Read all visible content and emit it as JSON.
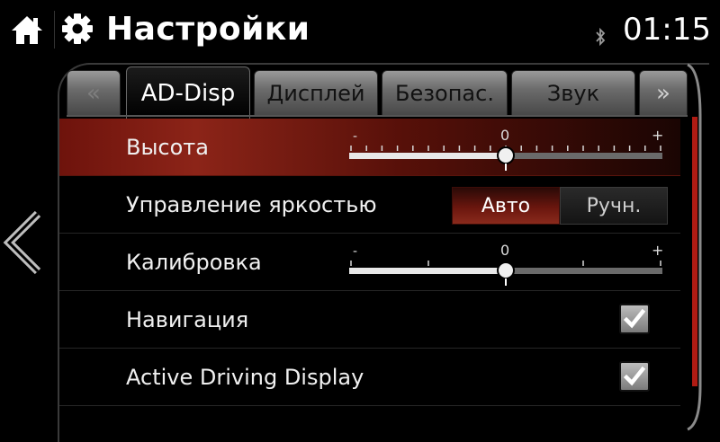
{
  "header": {
    "title": "Настройки",
    "time": "01:15"
  },
  "tabs": [
    {
      "label": "AD-Disp",
      "active": true
    },
    {
      "label": "Дисплей",
      "active": false
    },
    {
      "label": "Безопас.",
      "active": false
    },
    {
      "label": "Звук",
      "active": false
    }
  ],
  "tab_nav": {
    "prev_glyph": "«",
    "next_glyph": "»"
  },
  "rows": {
    "height": {
      "label": "Высота",
      "min_label": "-",
      "mid_label": "0",
      "max_label": "+",
      "value": 0
    },
    "brightness": {
      "label": "Управление яркостью",
      "options": [
        "Авто",
        "Ручн."
      ],
      "selected": "Авто"
    },
    "calibration": {
      "label": "Калибровка",
      "min_label": "-",
      "mid_label": "0",
      "max_label": "+",
      "value": 0
    },
    "navigation": {
      "label": "Навигация",
      "checked": true
    },
    "active_driving_display": {
      "label": "Active Driving Display",
      "checked": true
    }
  },
  "colors": {
    "accent_red": "#8c2418",
    "scrollbar_red": "#b01b13"
  }
}
